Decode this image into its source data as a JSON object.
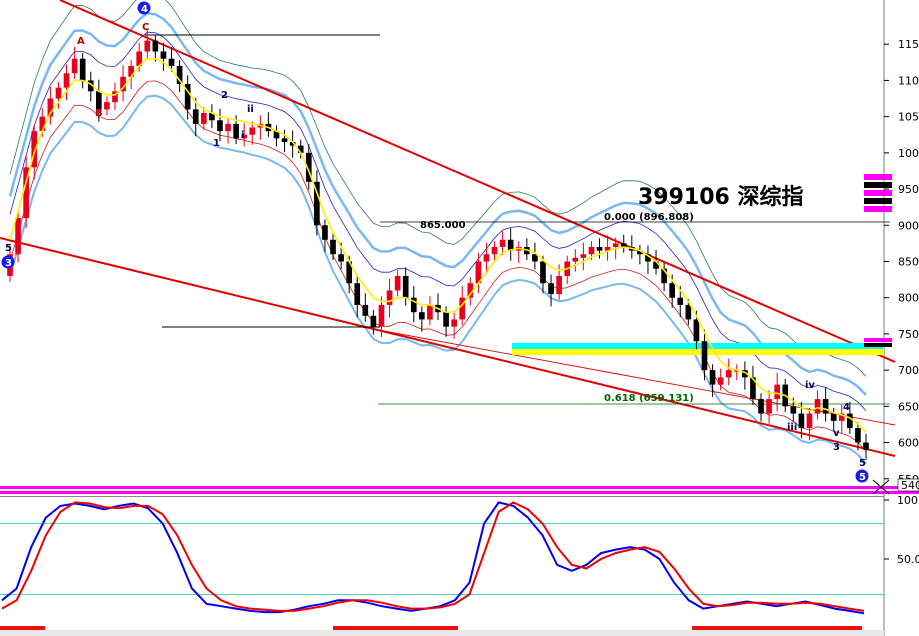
{
  "chart_data": [
    {
      "type": "candlestick",
      "title": "399106 深综指",
      "ylim": [
        540,
        1200
      ],
      "y_ticks": [
        550,
        600,
        650,
        700,
        750,
        800,
        850,
        900,
        950,
        1000,
        1050,
        1100,
        1150
      ],
      "last_price_label": "540",
      "closes": [
        860,
        910,
        980,
        1030,
        1050,
        1075,
        1090,
        1110,
        1130,
        1100,
        1085,
        1060,
        1070,
        1085,
        1105,
        1120,
        1140,
        1155,
        1140,
        1130,
        1120,
        1095,
        1060,
        1040,
        1055,
        1045,
        1030,
        1040,
        1020,
        1025,
        1035,
        1040,
        1030,
        1020,
        1015,
        1010,
        1000,
        960,
        900,
        880,
        860,
        850,
        820,
        790,
        775,
        760,
        790,
        810,
        830,
        800,
        780,
        770,
        790,
        780,
        760,
        770,
        800,
        820,
        850,
        860,
        870,
        880,
        865,
        870,
        860,
        850,
        820,
        805,
        830,
        850,
        855,
        860,
        870,
        865,
        870,
        875,
        870,
        865,
        860,
        850,
        840,
        820,
        800,
        790,
        770,
        740,
        700,
        680,
        690,
        700,
        700,
        690,
        660,
        640,
        660,
        680,
        650,
        640,
        620,
        640,
        660,
        640,
        630,
        640,
        620,
        600,
        590
      ],
      "ma_short_values": [
        880,
        920,
        960,
        1000,
        1030,
        1055,
        1070,
        1085,
        1100,
        1100,
        1095,
        1085,
        1080,
        1080,
        1090,
        1105,
        1120,
        1130,
        1130,
        1125,
        1115,
        1100,
        1085,
        1070,
        1060,
        1055,
        1050,
        1048,
        1045,
        1043,
        1040,
        1038,
        1035,
        1030,
        1025,
        1015,
        1000,
        975,
        945,
        915,
        890,
        870,
        850,
        830,
        815,
        800,
        795,
        795,
        800,
        800,
        795,
        790,
        790,
        785,
        780,
        780,
        790,
        805,
        820,
        835,
        850,
        862,
        866,
        868,
        866,
        862,
        852,
        842,
        838,
        840,
        845,
        850,
        856,
        860,
        864,
        868,
        870,
        868,
        865,
        858,
        850,
        838,
        824,
        810,
        795,
        775,
        752,
        730,
        712,
        703,
        700,
        697,
        688,
        675,
        668,
        668,
        665,
        657,
        648,
        644,
        648,
        646,
        641,
        638,
        634,
        626,
        614
      ]
    },
    {
      "type": "line",
      "ylim": [
        0,
        100
      ],
      "y_ticks": [
        50,
        100
      ],
      "y_tick_labels": [
        "50.0",
        "100."
      ],
      "series": [
        {
          "color": "#0000ee",
          "values": [
            15,
            25,
            60,
            85,
            95,
            97,
            95,
            92,
            95,
            97,
            93,
            80,
            55,
            25,
            12,
            10,
            8,
            6,
            5,
            5,
            7,
            10,
            12,
            15,
            15,
            13,
            10,
            8,
            6,
            8,
            10,
            15,
            30,
            80,
            98,
            95,
            85,
            70,
            45,
            40,
            45,
            55,
            58,
            60,
            58,
            50,
            30,
            15,
            8,
            10,
            12,
            14,
            12,
            10,
            12,
            14,
            11,
            8,
            6,
            4
          ]
        },
        {
          "color": "#ee0000",
          "values": [
            8,
            15,
            40,
            70,
            90,
            98,
            97,
            94,
            93,
            95,
            95,
            88,
            70,
            45,
            25,
            15,
            10,
            8,
            7,
            6,
            6,
            8,
            10,
            13,
            15,
            15,
            13,
            10,
            8,
            8,
            9,
            12,
            20,
            55,
            90,
            98,
            92,
            80,
            60,
            45,
            42,
            50,
            55,
            58,
            60,
            56,
            42,
            25,
            12,
            10,
            11,
            13,
            13,
            12,
            12,
            13,
            12,
            10,
            8,
            6
          ]
        }
      ],
      "guide_levels": [
        80,
        20
      ]
    }
  ],
  "annotations": {
    "fib_0": "0.000 (896.808)",
    "fib_618": "0.618 (659.131)",
    "level_865": "865.000",
    "wave_labels": [
      "A",
      "B",
      "C",
      "4",
      "2",
      "ii",
      "1",
      "i",
      "5",
      "3",
      "iii",
      "iv",
      "v",
      "4",
      "3",
      "5",
      "5"
    ]
  },
  "colors": {
    "bull": "#e8001c",
    "bear": "#000000",
    "ma_short": "#ffee00",
    "trend_red": "#e00000",
    "band_blue": "#7ab8f5",
    "band_blue_thin": "#2222cc",
    "cyan_band": "#00ffff",
    "yellow_band": "#ffff00",
    "magenta": "#ff00ff"
  }
}
